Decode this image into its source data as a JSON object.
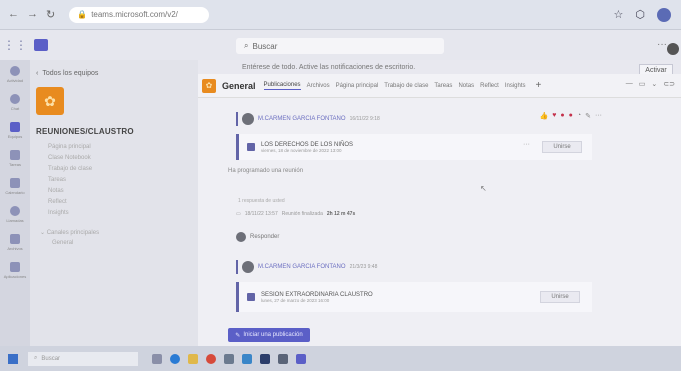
{
  "browser": {
    "url": "teams.microsoft.com/v2/"
  },
  "teams_top": {
    "search_placeholder": "Buscar"
  },
  "banner": {
    "text": "Entérese de todo. Active las notificaciones de escritorio.",
    "button": "Activar"
  },
  "rail": {
    "items": [
      "Actividad",
      "Chat",
      "Equipos",
      "Tareas",
      "Calendario",
      "Llamadas",
      "Archivos",
      "Aplicaciones"
    ]
  },
  "sidebar": {
    "back": "Todos los equipos",
    "team_name": "REUNIONES/CLAUSTRO",
    "nav": [
      "Página principal",
      "Clase Notebook",
      "Trabajo de clase",
      "Tareas",
      "Notas",
      "Reflect",
      "Insights"
    ],
    "channels_head": "Canales principales",
    "channel": "General"
  },
  "channel": {
    "name": "General",
    "tabs": [
      "Publicaciones",
      "Archivos",
      "Página principal",
      "Trabajo de clase",
      "Tareas",
      "Notas",
      "Reflect",
      "Insights"
    ],
    "add_tab": "+"
  },
  "posts": [
    {
      "author": "M.CARMEN GARCIA FONTANO",
      "time": "16/11/22 9:18",
      "meeting_title": "LOS DERECHOS DE LOS NIÑOS",
      "meeting_sub": "viernes, 18 de noviembre de 2022 13:00",
      "join": "Unirse",
      "message": "Ha programado una reunión",
      "replies": "1 respuesta de usted",
      "ended_time": "18/11/22 13:57",
      "ended_label": "Reunión finalizada",
      "ended_duration": "2h 12 m 47s",
      "reply": "Responder"
    },
    {
      "author": "M.CARMEN GARCIA FONTANO",
      "time": "21/3/23 9:48",
      "meeting_title": "SESION EXTRAORDINARIA CLAUSTRO",
      "meeting_sub": "lunes, 27 de marzo de 2023 16:00",
      "join": "Unirse"
    }
  ],
  "start_post": "Iniciar una publicación",
  "taskbar": {
    "search": "Buscar"
  }
}
